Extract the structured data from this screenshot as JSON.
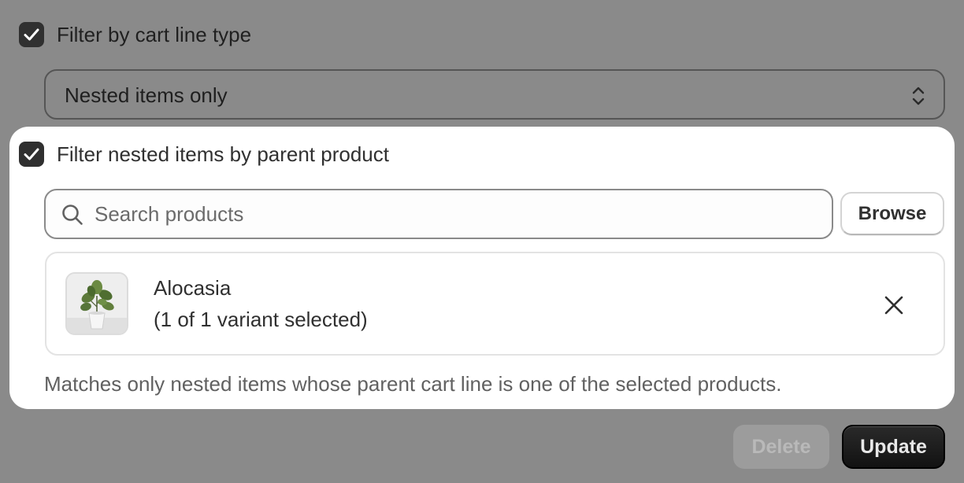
{
  "filter_cart_line_type": {
    "label": "Filter by cart line type",
    "checked": true
  },
  "cart_line_type_select": {
    "value": "Nested items only",
    "icon": "chevron-up-down-icon"
  },
  "filter_parent_product": {
    "label": "Filter nested items by parent product",
    "checked": true
  },
  "search": {
    "placeholder": "Search products",
    "value": "",
    "icon": "search-icon"
  },
  "browse": {
    "label": "Browse"
  },
  "selected_product": {
    "name": "Alocasia",
    "variant_summary": "(1 of 1 variant selected)",
    "thumbnail_icon": "potted-plant-image",
    "remove_icon": "close-icon"
  },
  "help_text": "Matches only nested items whose parent cart line is one of the selected products.",
  "actions": {
    "delete_label": "Delete",
    "update_label": "Update"
  },
  "colors": {
    "overlay_background": "#8a8a8a",
    "panel_background": "#ffffff",
    "checkbox_fill": "#303030",
    "primary_button": "#1a1a1a"
  }
}
